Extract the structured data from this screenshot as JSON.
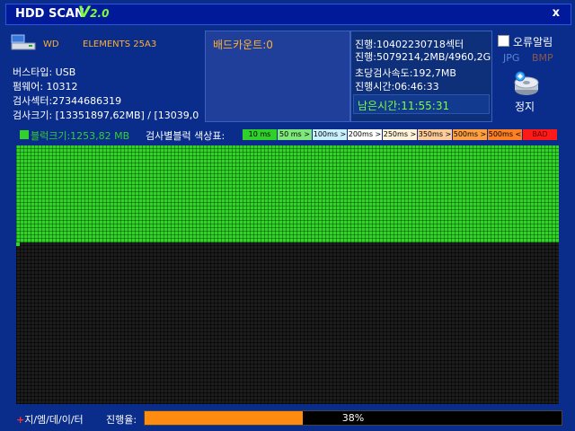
{
  "app": {
    "name": "HDD SCAN",
    "version_major": "V",
    "version_minor": "2.0",
    "close": "x"
  },
  "drive": {
    "name": "WD",
    "model": "ELEMENTS 25A3",
    "bus": "버스타입: USB",
    "firmware": "펌웨어: 10312",
    "sectors": "검사섹터:27344686319",
    "size": "검사크기: [13351897,62MB] / [13039,0"
  },
  "bad": {
    "count_label": "배드카운트:0"
  },
  "progress_info": {
    "sector_line": "진행:10402230718섹터",
    "mb_line": "진행:5079214,2MB/4960,2GB",
    "speed": "초당검사속도:192,7MB",
    "elapsed": "진행시간:06:46:33",
    "remaining": "남은시간:11:55:31"
  },
  "options": {
    "alarm_label": "오류알림",
    "alarm_checked": false,
    "jpg": "JPG",
    "bmp": "BMP",
    "stop_label": "정지"
  },
  "legend": {
    "block_size": "블럭크기:1253,82 MB",
    "title": "검사별블럭 색상표:",
    "chips": [
      {
        "label": "10 ms",
        "color": "#2fd02a"
      },
      {
        "label": "50 ms >",
        "color": "#7fe87a"
      },
      {
        "label": "100ms >",
        "color": "#c8f0ff"
      },
      {
        "label": "200ms >",
        "color": "#ffffff"
      },
      {
        "label": "250ms >",
        "color": "#fff4d8"
      },
      {
        "label": "350ms >",
        "color": "#ffcc99"
      },
      {
        "label": "500ms >",
        "color": "#ffa040"
      },
      {
        "label": "500ms <",
        "color": "#ff8020"
      },
      {
        "label": "BAD",
        "color": "#ff1a1a"
      }
    ]
  },
  "scan": {
    "progress": 0.38
  },
  "footer": {
    "brand_plus": "+",
    "brand": "지/엠/데/이/터",
    "progress_label": "진행율:",
    "progress_text": "38%"
  }
}
